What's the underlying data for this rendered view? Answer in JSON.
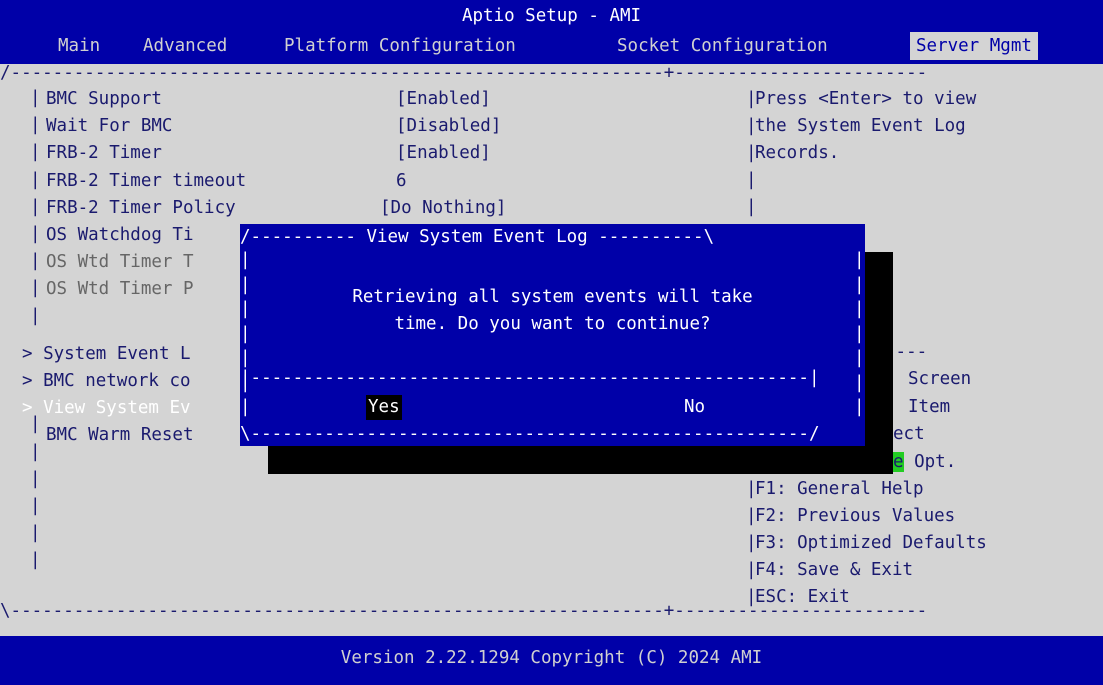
{
  "title": "Aptio Setup - AMI",
  "tabs": [
    "Main",
    "Advanced",
    "Platform Configuration",
    "Socket Configuration",
    "Server Mgmt"
  ],
  "active_tab": "Server Mgmt",
  "settings": [
    {
      "label": "BMC Support",
      "value": "[Enabled]"
    },
    {
      "label": "Wait For BMC",
      "value": "[Disabled]"
    },
    {
      "label": "FRB-2 Timer",
      "value": "[Enabled]"
    },
    {
      "label": "FRB-2 Timer timeout",
      "value": "6"
    },
    {
      "label": "FRB-2 Timer Policy",
      "value": "[Do Nothing]"
    }
  ],
  "partial_items": {
    "os_watchdog": "OS Watchdog Ti",
    "os_wtd_timeout": "OS Wtd Timer T",
    "os_wtd_policy": "OS Wtd Timer P",
    "system_event_log": "> System Event L",
    "bmc_network": "> BMC network co",
    "view_sel": "> View System Ev",
    "bmc_warm_reset": "BMC Warm Reset"
  },
  "help_text": [
    "Press <Enter> to view",
    "the System Event Log",
    "Records."
  ],
  "keys_partial": [
    "Screen",
    "Item",
    "ect",
    "e",
    "Opt."
  ],
  "keys": [
    "F1: General Help",
    "F2: Previous Values",
    "F3: Optimized Defaults",
    "F4: Save & Exit",
    "ESC: Exit"
  ],
  "dialog": {
    "title": "View System Event Log",
    "message_line1": "Retrieving all system events will take",
    "message_line2": "time. Do you want to continue?",
    "yes": "Yes",
    "no": "No"
  },
  "footer": "Version 2.22.1294 Copyright (C) 2024 AMI",
  "colors": {
    "bios_blue": "#0000a8",
    "background": "#d4d4d4",
    "text": "#1a1a6e",
    "highlight": "#22cc22"
  }
}
